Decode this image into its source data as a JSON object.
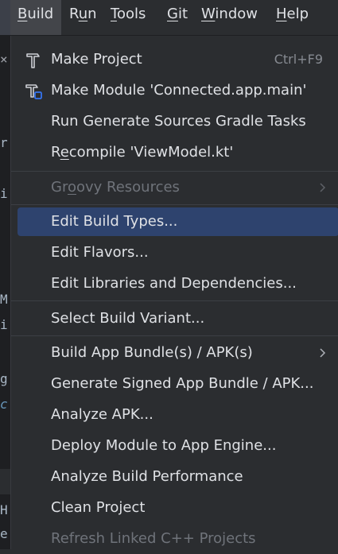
{
  "menubar": {
    "items": [
      {
        "pre": "",
        "mn": "B",
        "post": "uild"
      },
      {
        "pre": "R",
        "mn": "u",
        "post": "n"
      },
      {
        "pre": "",
        "mn": "T",
        "post": "ools"
      },
      {
        "pre": "",
        "mn": "G",
        "post": "it"
      },
      {
        "pre": "",
        "mn": "W",
        "post": "indow"
      },
      {
        "pre": "",
        "mn": "H",
        "post": "elp"
      }
    ]
  },
  "editor_glyphs": [
    "×",
    "r",
    "i",
    "M",
    "i",
    "g",
    "c",
    "H",
    "e"
  ],
  "menu": {
    "make_project": {
      "label": "Make Project",
      "shortcut": "Ctrl+F9"
    },
    "make_module": {
      "label": "Make Module 'Connected.app.main'"
    },
    "run_generate": {
      "label": "Run Generate Sources Gradle Tasks"
    },
    "recompile": {
      "pre": "R",
      "mn": "e",
      "post": "compile 'ViewModel.kt'"
    },
    "groovy_resources": {
      "pre": "Gr",
      "mn": "o",
      "post": "ovy Resources"
    },
    "edit_build_types": {
      "label": "Edit Build Types..."
    },
    "edit_flavors": {
      "label": "Edit Flavors..."
    },
    "edit_libraries": {
      "label": "Edit Libraries and Dependencies..."
    },
    "select_build_variant": {
      "label": "Select Build Variant..."
    },
    "build_app_bundle": {
      "label": "Build App Bundle(s) / APK(s)"
    },
    "generate_signed": {
      "label": "Generate Signed App Bundle / APK..."
    },
    "analyze_apk": {
      "label": "Analyze APK..."
    },
    "deploy_module": {
      "label": "Deploy Module to App Engine..."
    },
    "analyze_build_perf": {
      "label": "Analyze Build Performance"
    },
    "clean_project": {
      "label": "Clean Project"
    },
    "refresh_linked": {
      "label": "Refresh Linked C++ Projects"
    }
  },
  "colors": {
    "menu_bg": "#2b2d30",
    "selection": "#2e436e",
    "text": "#dfe1e5",
    "disabled_text": "#6f737a",
    "icon_blue": "#3574f0"
  },
  "icons": {
    "make_project": "hammer-icon",
    "make_module": "hammer-module-icon",
    "submenu": "chevron-right-icon"
  }
}
